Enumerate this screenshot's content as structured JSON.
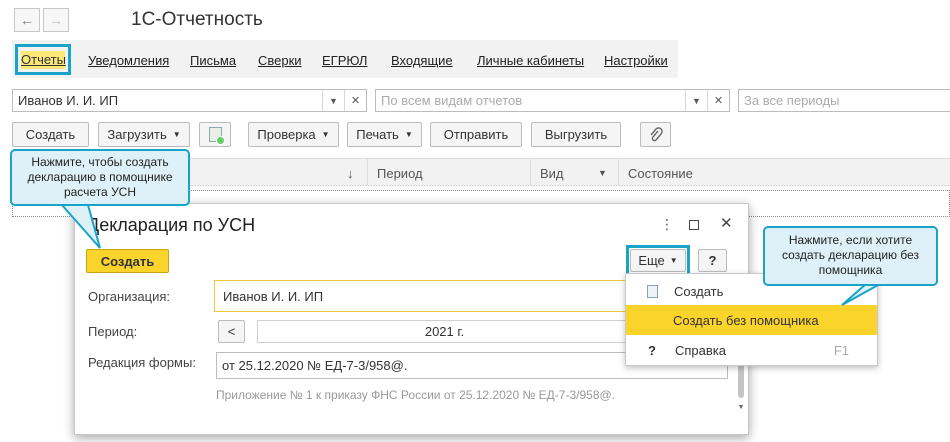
{
  "window": {
    "title": "1С-Отчетность",
    "back_glyph": "←",
    "forward_glyph": "→"
  },
  "tabs": {
    "active": "Отчеты",
    "items": [
      "Уведомления",
      "Письма",
      "Сверки",
      "ЕГРЮЛ",
      "Входящие",
      "Личные кабинеты",
      "Настройки"
    ]
  },
  "filters": {
    "organization": "Иванов И. И. ИП",
    "report_types_placeholder": "По всем видам отчетов",
    "period_placeholder": "За все периоды"
  },
  "toolbar": {
    "create": "Создать",
    "load": "Загрузить",
    "check": "Проверка",
    "print": "Печать",
    "send": "Отправить",
    "export": "Выгрузить"
  },
  "grid": {
    "sort_glyph": "↓",
    "col_period": "Период",
    "col_type": "Вид",
    "col_status": "Состояние"
  },
  "callouts": {
    "left": "Нажмите, чтобы создать декларацию в помощнике расчета УСН",
    "right": "Нажмите, если хотите создать декларацию без помощника"
  },
  "dialog": {
    "title": "Декларация по УСН",
    "create_button": "Создать",
    "more_button": "Еще",
    "help_button": "?",
    "org_label": "Организация:",
    "org_value": "Иванов И. И. ИП",
    "period_label": "Период:",
    "period_value": "2021 г.",
    "prev_glyph": "<",
    "form_label": "Редакция формы:",
    "form_value": "от 25.12.2020 № ЕД-7-3/958@.",
    "note": "Приложение № 1 к приказу ФНС России от 25.12.2020 № ЕД-7-3/958@."
  },
  "more_menu": {
    "items": [
      {
        "label": "Создать",
        "icon": "document-icon",
        "shortcut": ""
      },
      {
        "label": "Создать без помощника",
        "icon": "",
        "shortcut": ""
      },
      {
        "label": "Справка",
        "icon": "question-icon",
        "shortcut": "F1"
      }
    ],
    "highlighted_index": 1
  },
  "colors": {
    "accent": "#1aa3c8",
    "highlight": "#fce877",
    "primary_button": "#fad42b"
  }
}
